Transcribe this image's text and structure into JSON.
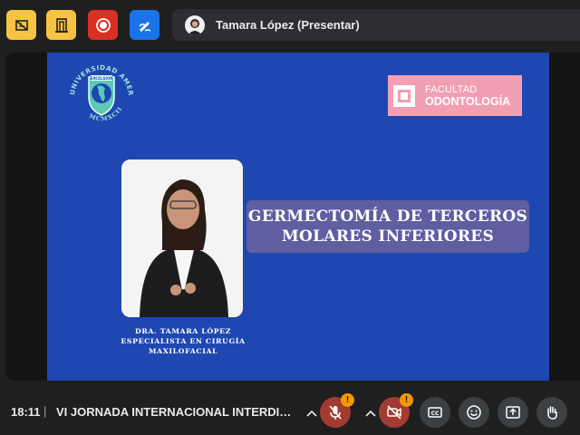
{
  "top_bar": {
    "presenter_label": "Tamara López (Presentar)"
  },
  "slide": {
    "seal_ring_top": "UNIVERSIDAD AMERICANA",
    "seal_year": "MCMXCII",
    "seal_banner": "EXCELSIOR",
    "faculty_line1": "FACULTAD",
    "faculty_line2": "ODONTOLOGÍA",
    "title_line1": "GERMECTOMÍA DE TERCEROS",
    "title_line2": "MOLARES INFERIORES",
    "caption_line1": "DRA. TAMARA LÓPEZ",
    "caption_line2": "ESPECIALISTA EN CIRUGÍA",
    "caption_line3": "MAXILOFACIAL"
  },
  "bottom_bar": {
    "time": "18:11",
    "separator": "|",
    "meeting_title": "VI JORNADA INTERNACIONAL INTERDI…",
    "mic_warning": "!",
    "cam_warning": "!"
  },
  "icons": {
    "top": [
      "hand-raise-icon",
      "door-icon",
      "record-icon",
      "pen-icon"
    ],
    "bottom": [
      "chevron-up-icon",
      "mic-off-icon",
      "camera-off-icon",
      "captions-icon",
      "emoji-icon",
      "present-icon",
      "hand-icon"
    ]
  },
  "colors": {
    "app_background": "#1f1f1f",
    "slide_background": "#1e47b2",
    "title_box": "#5f5ea0",
    "faculty_logo": "#f29fb3",
    "accent_yellow": "#f6c342",
    "record_red": "#d93025",
    "pen_blue": "#1a73e8",
    "muted_red": "#a23b31",
    "warning_orange": "#f29900"
  }
}
